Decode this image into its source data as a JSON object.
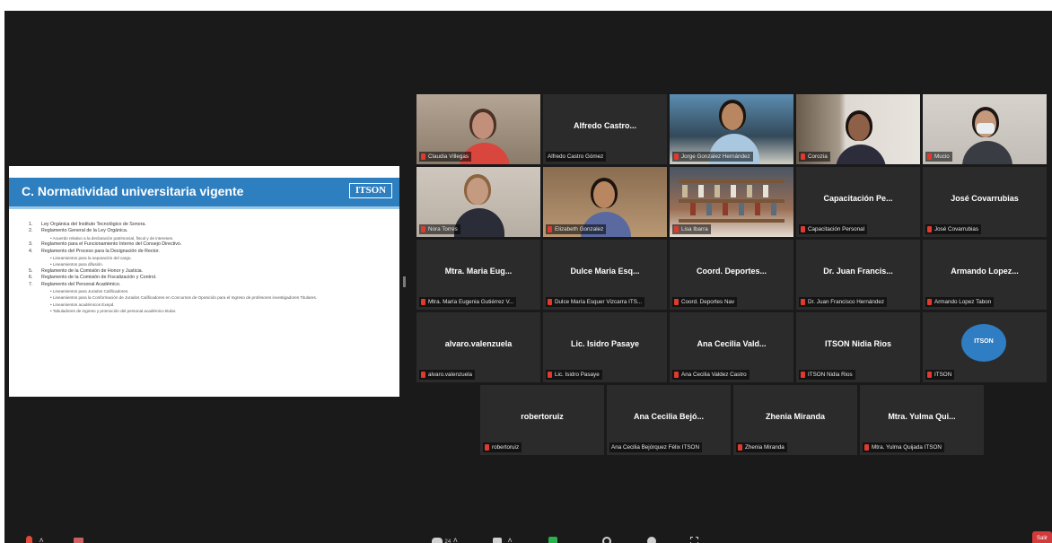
{
  "slide": {
    "title": "C. Normatividad universitaria vigente",
    "logo_text": "ITSON",
    "items": [
      {
        "num": "1.",
        "text": "Ley Orgánica del Instituto Tecnológico de Sonora.",
        "sub": []
      },
      {
        "num": "2.",
        "text": "Reglamento General de la Ley Orgánica.",
        "sub": [
          "Acuerdo relativo a la declaración patrimonial, fiscal y de intereses."
        ]
      },
      {
        "num": "3.",
        "text": "Reglamento para el Funcionamiento Interno del Consejo Directivo.",
        "sub": []
      },
      {
        "num": "4.",
        "text": "Reglamento del Proceso para la Designación de Rector.",
        "sub": [
          "Lineamientos para la separación del cargo.",
          "Lineamientos para difusión."
        ]
      },
      {
        "num": "5.",
        "text": "Reglamento de la Comisión de Honor y Justicia.",
        "sub": []
      },
      {
        "num": "6.",
        "text": "Reglamento de la Comisión de Fiscalización y Control.",
        "sub": []
      },
      {
        "num": "7.",
        "text": "Reglamento del Personal Académico.",
        "sub": [
          "Lineamientos para Jurados Calificadores.",
          "Lineamientos para la Conformación de Jurados Calificadores en Concursos de Oposición para el Ingreso de profesores investigadores Titulares.",
          "Lineamientos académicos Exepd.",
          "Tabuladores de ingreso y promoción del personal académico titular."
        ]
      }
    ]
  },
  "participants": [
    {
      "label": "",
      "caption": "Claudia Villegas",
      "video": true
    },
    {
      "label": "Alfredo Castro...",
      "caption": "Alfredo Castro Gómez",
      "video": false
    },
    {
      "label": "",
      "caption": "Jorge Gonzalez Hernández",
      "video": true
    },
    {
      "label": "",
      "caption": "Corozia",
      "video": true
    },
    {
      "label": "",
      "caption": "Mucio",
      "video": true
    },
    {
      "label": "",
      "caption": "Nora Torres",
      "video": true
    },
    {
      "label": "",
      "caption": "Elizabeth Gonzalez",
      "video": true
    },
    {
      "label": "",
      "caption": "Lisa Ibarra",
      "video": true
    },
    {
      "label": "Capacitación Pe...",
      "caption": "Capacitación Personal",
      "video": false
    },
    {
      "label": "José Covarrubias",
      "caption": "José Covarrubias",
      "video": false
    },
    {
      "label": "Mtra. Maria Eug...",
      "caption": "Mtra. María Eugenia Gutiérrez V...",
      "video": false
    },
    {
      "label": "Dulce Maria Esq...",
      "caption": "Dulce María Esquer Vizcarra ITS...",
      "video": false
    },
    {
      "label": "Coord. Deportes...",
      "caption": "Coord. Deportes Nav",
      "video": false
    },
    {
      "label": "Dr. Juan Francis...",
      "caption": "Dr. Juan Francisco Hernández",
      "video": false
    },
    {
      "label": "Armando Lopez...",
      "caption": "Armando Lopez Tabon",
      "video": false
    },
    {
      "label": "alvaro.valenzuela",
      "caption": "alvaro.valenzuela",
      "video": false
    },
    {
      "label": "Lic. Isidro Pasaye",
      "caption": "Lic. Isidro Pasaye",
      "video": false
    },
    {
      "label": "Ana Cecilia Vald...",
      "caption": "Ana Cecilia Valdez Castro",
      "video": false
    },
    {
      "label": "ITSON Nidia Rios",
      "caption": "ITSON Nidia Rios",
      "video": false
    },
    {
      "label": "",
      "caption": "ITSON",
      "video": true
    },
    {
      "label": "robertoruiz",
      "caption": "robertoruiz",
      "video": false
    },
    {
      "label": "Ana Cecilia Bejó...",
      "caption": "Ana Cecilia Bejórquez Félix ITSON",
      "video": false
    },
    {
      "label": "Zhenia Miranda",
      "caption": "Zhenia Miranda",
      "video": false
    },
    {
      "label": "Mtra. Yulma Qui...",
      "caption": "Mtra. Yulma Quijada ITSON",
      "video": false
    }
  ],
  "itson_badge_text": "ITSON",
  "toolbar": {
    "participants_count": "24",
    "end_label": "Salir"
  }
}
